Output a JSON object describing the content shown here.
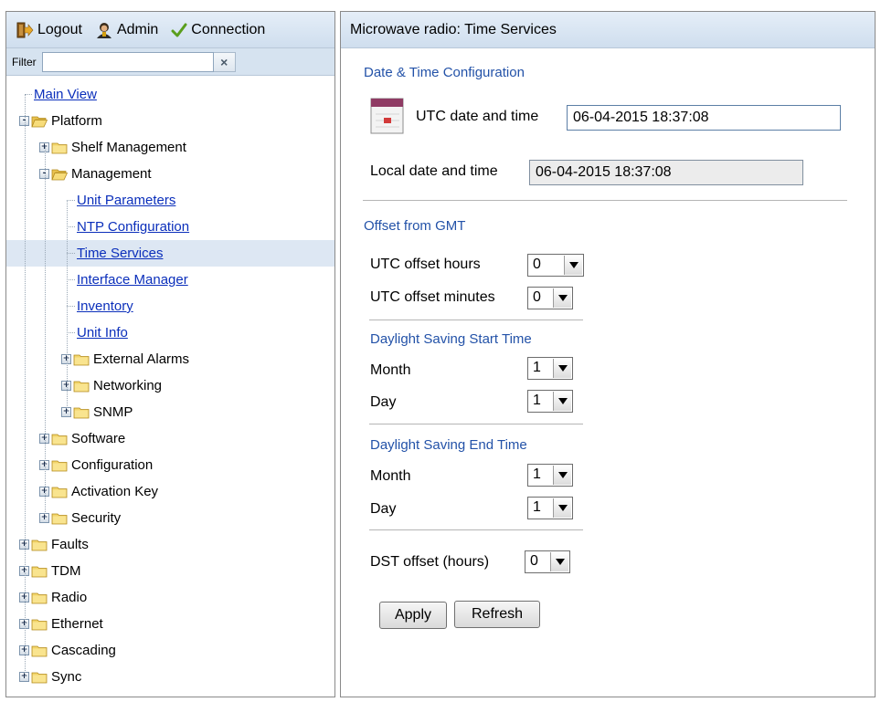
{
  "toolbar": {
    "logout_label": "Logout",
    "admin_label": "Admin",
    "connection_label": "Connection"
  },
  "filter": {
    "label": "Filter",
    "value": "",
    "clear_icon": "×"
  },
  "tree": [
    {
      "label": "Main View",
      "level": 0,
      "type": "link",
      "toggle": null,
      "folder": false
    },
    {
      "label": "Platform",
      "level": 0,
      "type": "folder",
      "toggle": "-",
      "folder": "open"
    },
    {
      "label": "Shelf Management",
      "level": 1,
      "type": "folder",
      "toggle": "+",
      "folder": "closed"
    },
    {
      "label": "Management",
      "level": 1,
      "type": "folder",
      "toggle": "-",
      "folder": "open"
    },
    {
      "label": "Unit Parameters",
      "level": 2,
      "type": "link",
      "toggle": null,
      "folder": false
    },
    {
      "label": "NTP Configuration",
      "level": 2,
      "type": "link",
      "toggle": null,
      "folder": false
    },
    {
      "label": "Time Services",
      "level": 2,
      "type": "link",
      "toggle": null,
      "folder": false,
      "selected": true
    },
    {
      "label": "Interface Manager",
      "level": 2,
      "type": "link",
      "toggle": null,
      "folder": false
    },
    {
      "label": "Inventory",
      "level": 2,
      "type": "link",
      "toggle": null,
      "folder": false
    },
    {
      "label": "Unit Info",
      "level": 2,
      "type": "link",
      "toggle": null,
      "folder": false
    },
    {
      "label": "External Alarms",
      "level": 2,
      "type": "folder",
      "toggle": "+",
      "folder": "closed"
    },
    {
      "label": "Networking",
      "level": 2,
      "type": "folder",
      "toggle": "+",
      "folder": "closed"
    },
    {
      "label": "SNMP",
      "level": 2,
      "type": "folder",
      "toggle": "+",
      "folder": "closed"
    },
    {
      "label": "Software",
      "level": 1,
      "type": "folder",
      "toggle": "+",
      "folder": "closed"
    },
    {
      "label": "Configuration",
      "level": 1,
      "type": "folder",
      "toggle": "+",
      "folder": "closed"
    },
    {
      "label": "Activation Key",
      "level": 1,
      "type": "folder",
      "toggle": "+",
      "folder": "closed"
    },
    {
      "label": "Security",
      "level": 1,
      "type": "folder",
      "toggle": "+",
      "folder": "closed"
    },
    {
      "label": "Faults",
      "level": 0,
      "type": "folder",
      "toggle": "+",
      "folder": "closed"
    },
    {
      "label": "TDM",
      "level": 0,
      "type": "folder",
      "toggle": "+",
      "folder": "closed"
    },
    {
      "label": "Radio",
      "level": 0,
      "type": "folder",
      "toggle": "+",
      "folder": "closed"
    },
    {
      "label": "Ethernet",
      "level": 0,
      "type": "folder",
      "toggle": "+",
      "folder": "closed"
    },
    {
      "label": "Cascading",
      "level": 0,
      "type": "folder",
      "toggle": "+",
      "folder": "closed"
    },
    {
      "label": "Sync",
      "level": 0,
      "type": "folder",
      "toggle": "+",
      "folder": "closed"
    }
  ],
  "main": {
    "header": "Microwave radio: Time Services",
    "datetime_section": "Date & Time Configuration",
    "utc_label": "UTC date and time",
    "utc_value": "06-04-2015 18:37:08",
    "local_label": "Local date and time",
    "local_value": "06-04-2015 18:37:08",
    "offset_section": "Offset from GMT",
    "utc_offset_hours_label": "UTC offset hours",
    "utc_offset_hours_value": "0",
    "utc_offset_minutes_label": "UTC offset minutes",
    "utc_offset_minutes_value": "0",
    "dst_start_section": "Daylight Saving Start Time",
    "dst_start_month_label": "Month",
    "dst_start_month_value": "1",
    "dst_start_day_label": "Day",
    "dst_start_day_value": "1",
    "dst_end_section": "Daylight Saving End Time",
    "dst_end_month_label": "Month",
    "dst_end_month_value": "1",
    "dst_end_day_label": "Day",
    "dst_end_day_value": "1",
    "dst_offset_label": "DST offset (hours)",
    "dst_offset_value": "0",
    "apply_label": "Apply",
    "refresh_label": "Refresh"
  },
  "colors": {
    "link": "#0b2fbb",
    "section_title": "#2352a8",
    "header_gradient_top": "#e5eef8",
    "header_gradient_bottom": "#cfdeee",
    "selected_row": "#dde7f3",
    "folder": "#f2d56b"
  }
}
